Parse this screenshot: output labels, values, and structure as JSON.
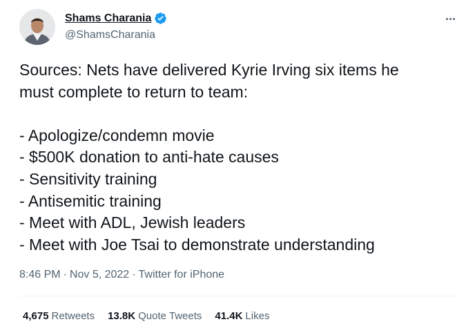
{
  "author": {
    "display_name": "Shams Charania",
    "handle": "@ShamsCharania",
    "verified_icon": "verified-badge-icon",
    "verified_color": "#1d9bf0"
  },
  "tweet": {
    "lines": [
      "Sources: Nets have delivered Kyrie Irving six items he",
      "must complete to return to team:",
      "",
      "- Apologize/condemn movie",
      "- $500K donation to anti-hate causes",
      "- Sensitivity training",
      "- Antisemitic training",
      "- Meet with ADL, Jewish leaders",
      "- Meet with Joe Tsai to demonstrate understanding"
    ]
  },
  "meta": {
    "time": "8:46 PM",
    "separator": "·",
    "date": "Nov 5, 2022",
    "source": "Twitter for iPhone"
  },
  "stats": {
    "retweets_count": "4,675",
    "retweets_label": "Retweets",
    "quote_count": "13.8K",
    "quote_label": "Quote Tweets",
    "likes_count": "41.4K",
    "likes_label": "Likes"
  },
  "colors": {
    "text": "#0f1419",
    "secondary": "#536471",
    "divider": "#eff3f4"
  }
}
